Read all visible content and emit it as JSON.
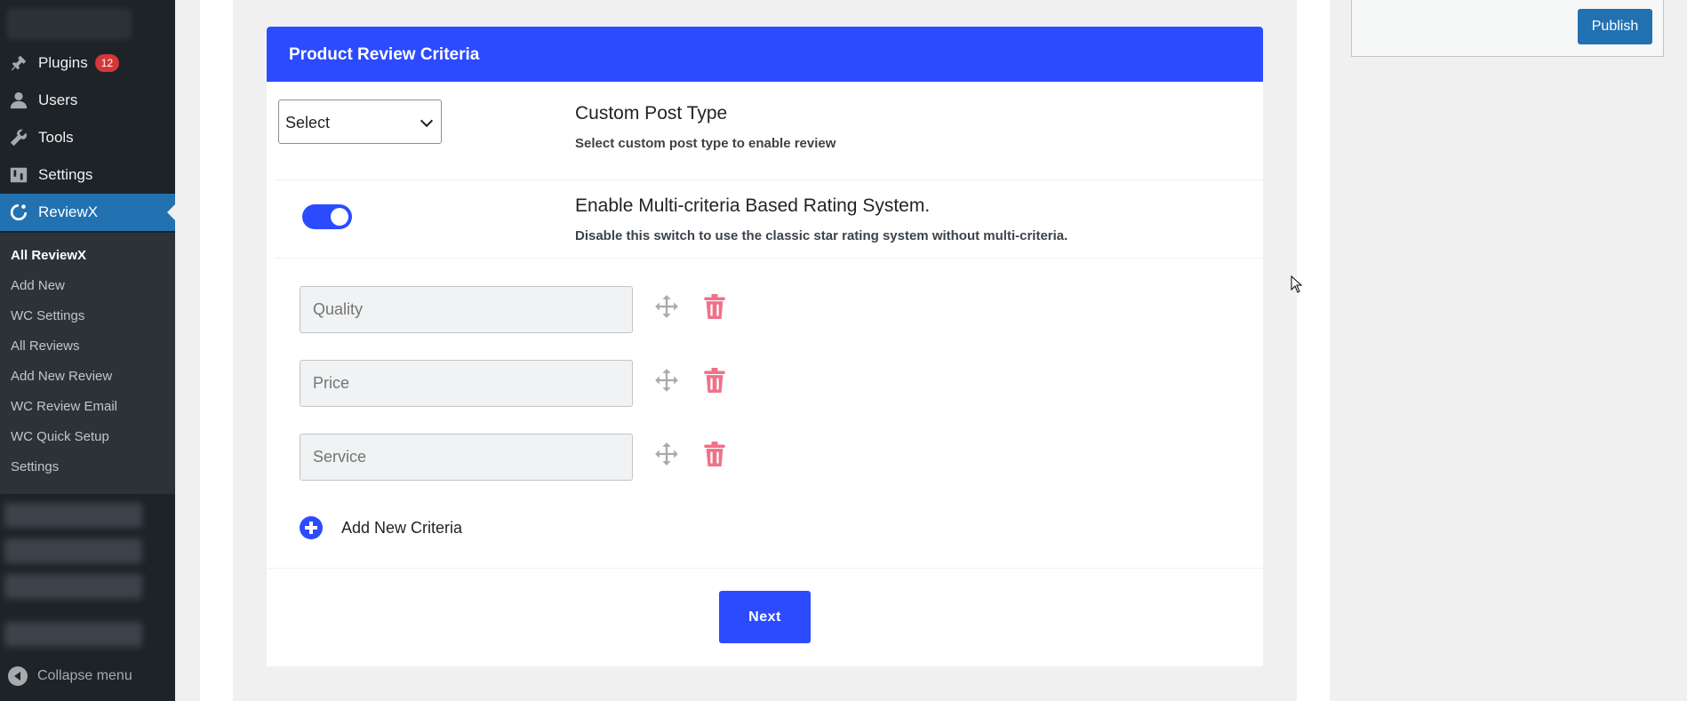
{
  "sidebar": {
    "menu": [
      {
        "label": "Plugins",
        "badge": "12",
        "icon": "plugin-icon"
      },
      {
        "label": "Users",
        "icon": "users-icon"
      },
      {
        "label": "Tools",
        "icon": "wrench-icon"
      },
      {
        "label": "Settings",
        "icon": "settings-icon"
      },
      {
        "label": "ReviewX",
        "icon": "reviewx-icon",
        "active": true
      }
    ],
    "submenu": [
      "All ReviewX",
      "Add New",
      "WC Settings",
      "All Reviews",
      "Add New Review",
      "WC Review Email",
      "WC Quick Setup",
      "Settings"
    ],
    "collapse_label": "Collapse menu"
  },
  "card": {
    "header_title": "Product Review Criteria",
    "select_value": "Select",
    "custom_post_type_title": "Custom Post Type",
    "custom_post_type_desc": "Select custom post type to enable review",
    "multi_criteria_title": "Enable Multi-criteria Based Rating System.",
    "multi_criteria_desc": "Disable this switch to use the classic star rating system without multi-criteria.",
    "multi_criteria_enabled": true,
    "criteria": [
      {
        "placeholder": "Quality"
      },
      {
        "placeholder": "Price"
      },
      {
        "placeholder": "Service"
      }
    ],
    "add_new_label": "Add New Criteria",
    "next_label": "Next"
  },
  "publish": {
    "label": "Publish"
  },
  "colors": {
    "accent": "#2c4bff",
    "wp_blue": "#2271b1",
    "trash": "#f0708a",
    "sidebar_bg": "#1d2327"
  }
}
